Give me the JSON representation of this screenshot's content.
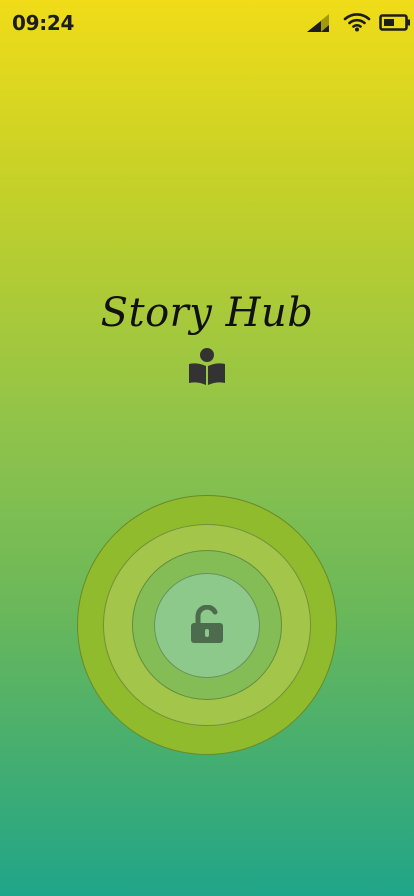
{
  "status_bar": {
    "time": "09:24",
    "icons": [
      "signal-icon",
      "wifi-icon",
      "battery-icon"
    ]
  },
  "app": {
    "title": "Story Hub",
    "logo_icon": "reader-book-icon"
  },
  "unlock": {
    "icon": "unlock-icon"
  },
  "colors": {
    "gradient_top": "#f0dc18",
    "gradient_bottom": "#20a589",
    "ring_outer": "#90bb2c",
    "ring_second": "#a2c54a",
    "ring_third": "#84bd55",
    "ring_inner": "#8dc98a",
    "icon_dark": "#333333",
    "lock_icon": "#4d6b4d"
  }
}
